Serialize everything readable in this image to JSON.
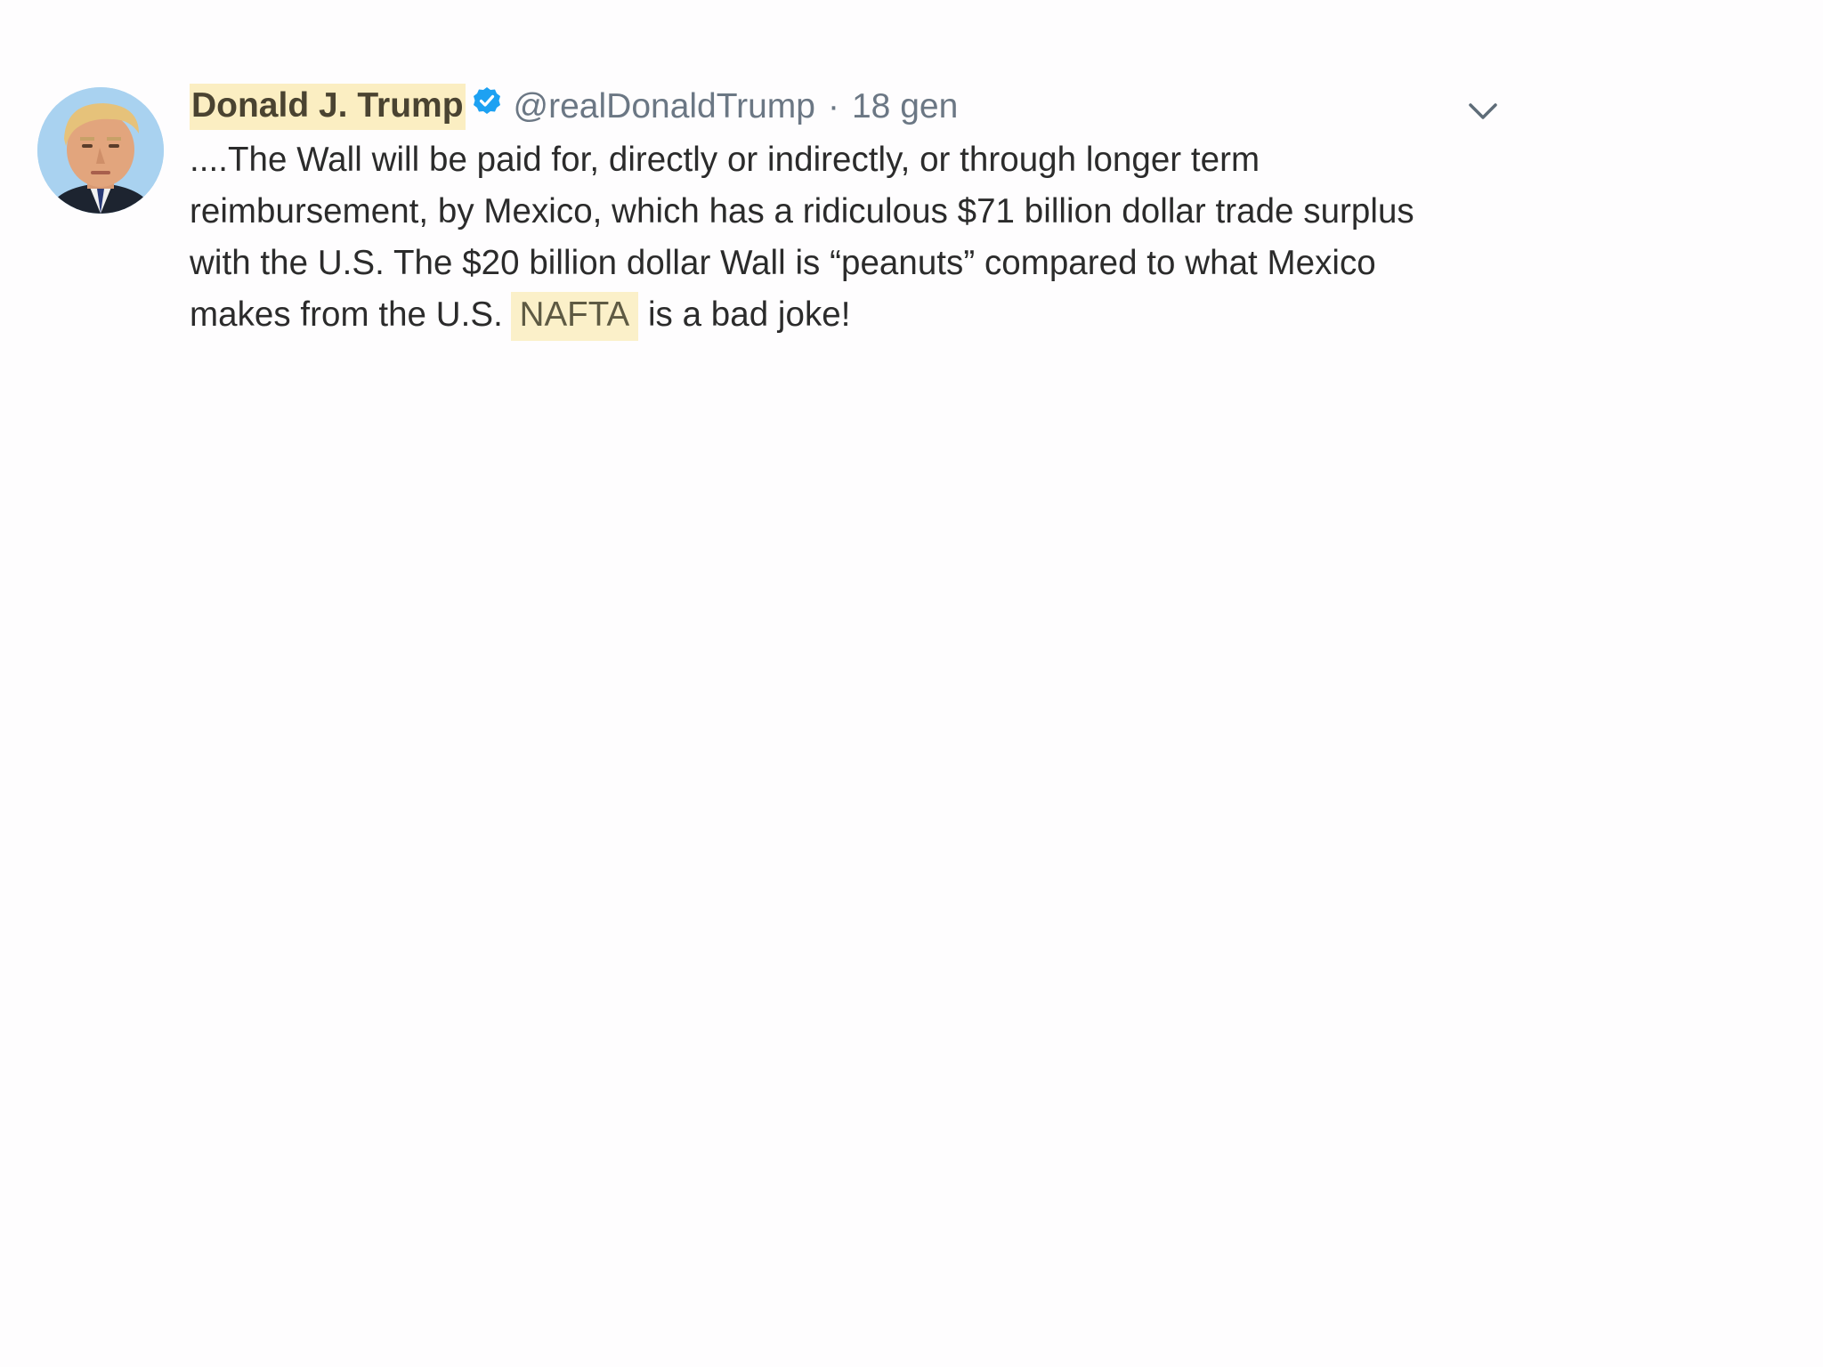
{
  "tweet": {
    "author_name": "Donald J. Trump",
    "verified_icon": "verified-badge-icon",
    "handle": "@realDonaldTrump",
    "separator": "·",
    "time": "18 gen",
    "menu_icon": "chevron-down-icon",
    "text_lines": {
      "line1": "....The Wall will be paid for, directly or indirectly, or through longer term",
      "line2": "reimbursement, by Mexico, which has a ridiculous $71 billion dollar trade surplus",
      "line3": "with the U.S. The $20 billion dollar Wall is “peanuts” compared to what Mexico",
      "line4_before": "makes from the U.S.",
      "line4_highlight": "NAFTA",
      "line4_after": "is a bad joke!"
    }
  },
  "colors": {
    "background": "#fefdfe",
    "highlight": "#fbf0c9",
    "verified_blue": "#1da1f2",
    "muted_text": "#6b7784",
    "body_text": "#2b2b2b"
  }
}
